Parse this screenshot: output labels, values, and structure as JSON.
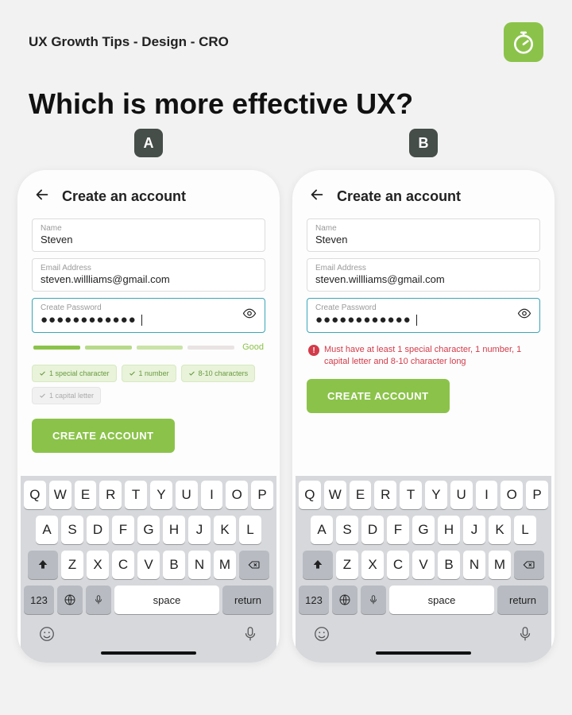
{
  "header": {
    "title": "UX Growth Tips - Design - CRO"
  },
  "main_title": "Which is more effective UX?",
  "badges": {
    "a": "A",
    "b": "B"
  },
  "screen": {
    "title": "Create an account",
    "name_label": "Name",
    "name_value": "Steven",
    "email_label": "Email Address",
    "email_value": "steven.willliams@gmail.com",
    "password_label": "Create Password",
    "password_dots": "●●●●●●●●●●●●",
    "cta": "CREATE ACCOUNT"
  },
  "variant_a": {
    "strength_label": "Good",
    "strength_colors": [
      "#8bc34a",
      "#b7da8a",
      "#c9e3a8",
      "#e9e3e3"
    ],
    "chips": [
      {
        "label": "1 special character",
        "ok": true
      },
      {
        "label": "1 number",
        "ok": true
      },
      {
        "label": "8-10 characters",
        "ok": true
      },
      {
        "label": "1 capital letter",
        "ok": false
      }
    ]
  },
  "variant_b": {
    "error_text": "Must have at least 1 special character, 1 number, 1 capital letter and 8-10 character long"
  },
  "keyboard": {
    "row1": [
      "Q",
      "W",
      "E",
      "R",
      "T",
      "Y",
      "U",
      "I",
      "O",
      "P"
    ],
    "row2": [
      "A",
      "S",
      "D",
      "F",
      "G",
      "H",
      "J",
      "K",
      "L"
    ],
    "row3": [
      "Z",
      "X",
      "C",
      "V",
      "B",
      "N",
      "M"
    ],
    "num": "123",
    "space": "space",
    "return": "return"
  }
}
